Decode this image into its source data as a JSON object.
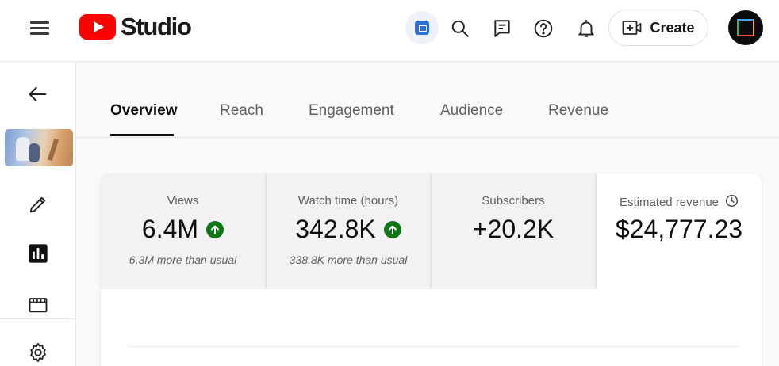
{
  "header": {
    "logo_text": "Studio",
    "create_label": "Create"
  },
  "icons": {
    "menu": "hamburger-menu-icon",
    "app": "studio-app-icon",
    "search": "search-icon",
    "feedback": "feedback-icon",
    "help": "help-icon",
    "notifications": "bell-icon",
    "create": "create-video-icon",
    "back": "arrow-back-icon",
    "edit": "pencil-icon",
    "analytics": "analytics-icon",
    "editor": "clapperboard-icon",
    "settings": "gear-icon"
  },
  "tabs": [
    {
      "label": "Overview",
      "active": true
    },
    {
      "label": "Reach",
      "active": false
    },
    {
      "label": "Engagement",
      "active": false
    },
    {
      "label": "Audience",
      "active": false
    },
    {
      "label": "Revenue",
      "active": false
    }
  ],
  "metrics": [
    {
      "label": "Views",
      "value": "6.4M",
      "trend": "up",
      "note": "6.3M more than usual"
    },
    {
      "label": "Watch time (hours)",
      "value": "342.8K",
      "trend": "up",
      "note": "338.8K more than usual"
    },
    {
      "label": "Subscribers",
      "value": "+20.2K"
    },
    {
      "label": "Estimated revenue",
      "value": "$24,777.23"
    }
  ],
  "colors": {
    "brand": "#ff0000",
    "trend_up": "#107516",
    "accent": "#2e6fd6"
  }
}
